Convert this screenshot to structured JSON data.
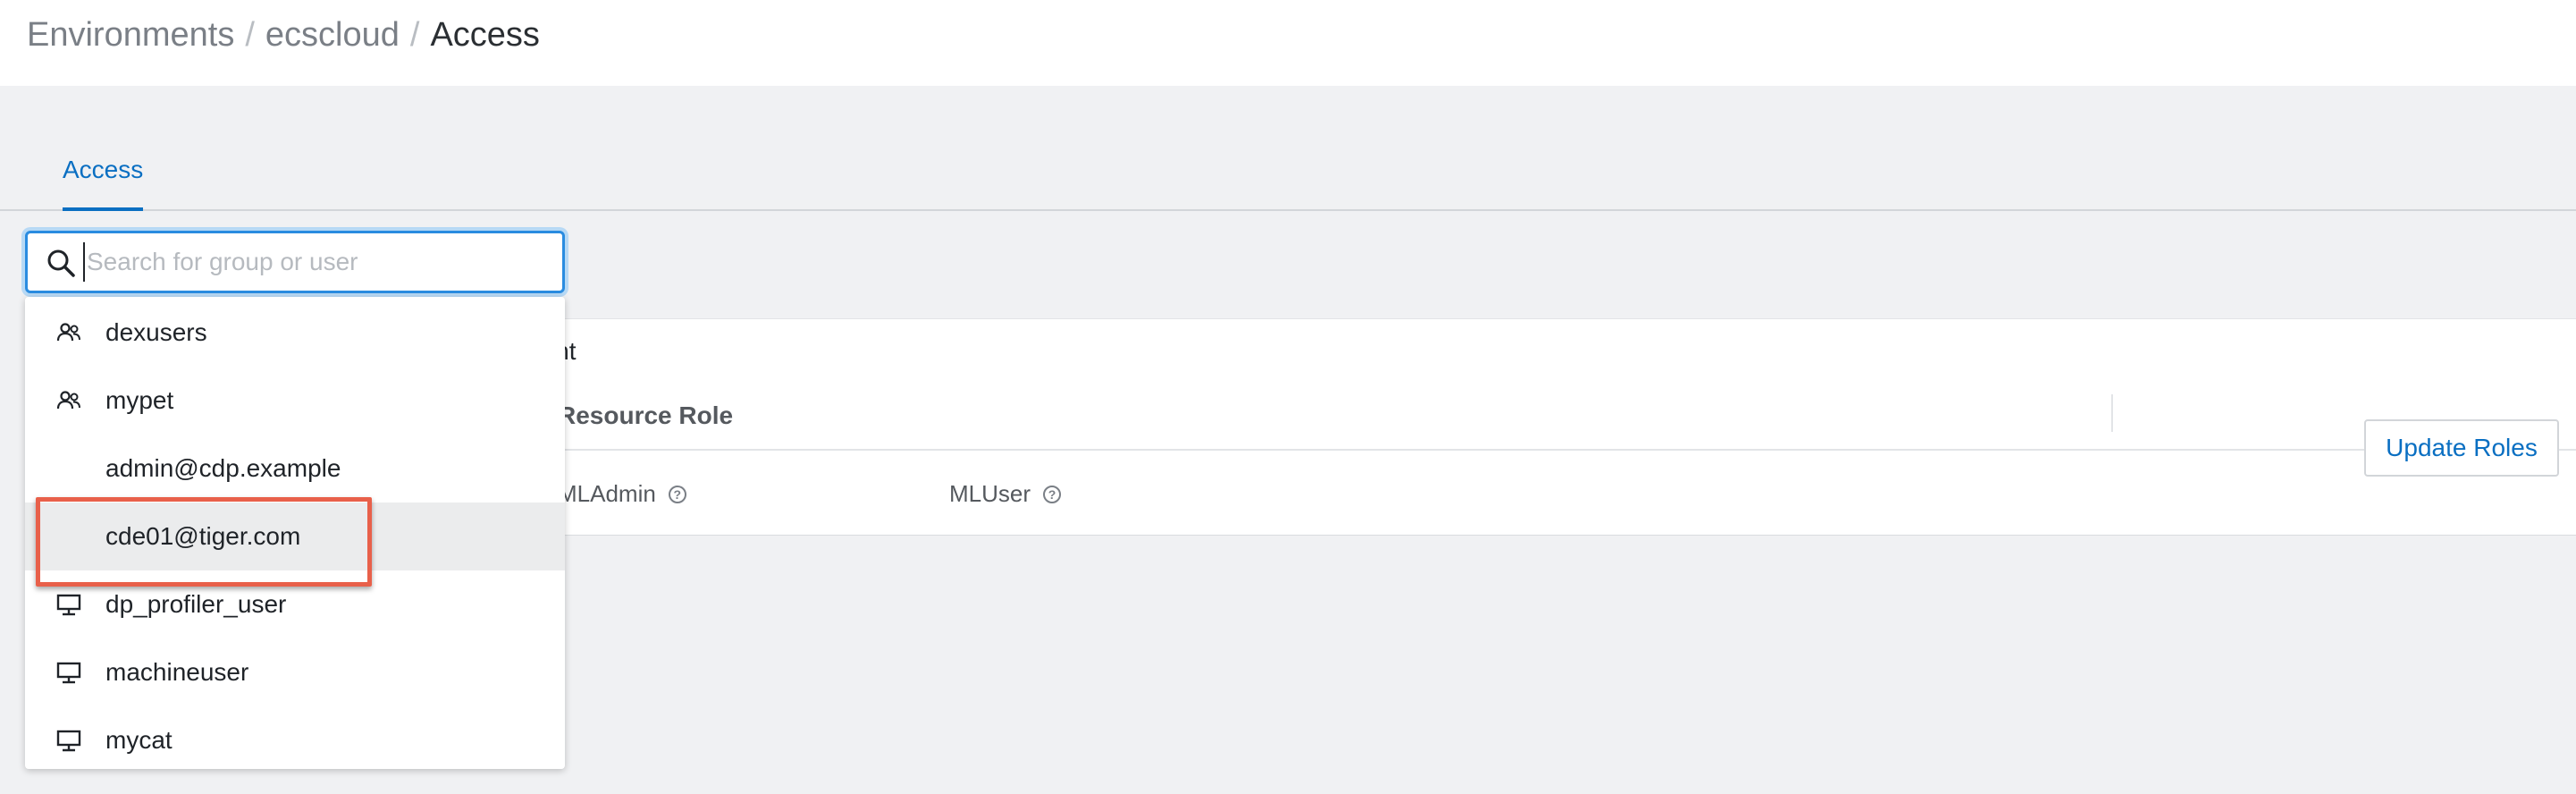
{
  "breadcrumb": {
    "items": [
      "Environments",
      "ecscloud"
    ],
    "separator": "/",
    "current": "Access"
  },
  "tabs": [
    {
      "label": "Access",
      "active": true
    }
  ],
  "search": {
    "placeholder": "Search for group or user",
    "value": ""
  },
  "dropdown": {
    "items": [
      {
        "label": "dexusers",
        "icon": "group-icon"
      },
      {
        "label": "mypet",
        "icon": "group-icon"
      },
      {
        "label": "admin@cdp.example",
        "icon": ""
      },
      {
        "label": "cde01@tiger.com",
        "icon": "",
        "hovered": true,
        "highlighted": true
      },
      {
        "label": "dp_profiler_user",
        "icon": "machine-user-icon"
      },
      {
        "label": "machineuser",
        "icon": "machine-user-icon"
      },
      {
        "label": "mycat",
        "icon": "machine-user-icon"
      }
    ]
  },
  "card": {
    "title_partial": "nent",
    "column_header": "Resource Role",
    "roles": [
      {
        "label": "MLAdmin"
      },
      {
        "label": "MLUser"
      }
    ],
    "update_button": "Update Roles"
  },
  "colors": {
    "accent": "#0a6fc2",
    "highlight": "#e8604a",
    "background": "#f0f1f3"
  }
}
